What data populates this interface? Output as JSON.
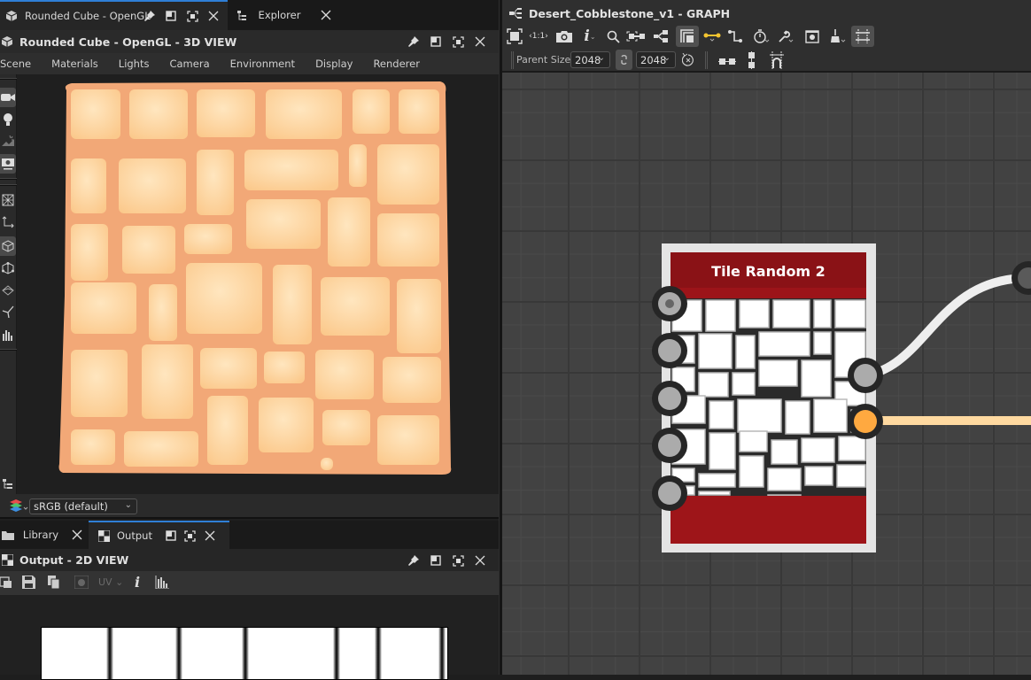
{
  "top_tabs": [
    {
      "label": "Rounded Cube - OpenGL",
      "icon": "cube-icon",
      "active": true
    },
    {
      "label": "Explorer",
      "icon": "tree-icon",
      "active": false
    }
  ],
  "view3d": {
    "title": "Rounded Cube - OpenGL - 3D VIEW",
    "menu": [
      "Scene",
      "Materials",
      "Lights",
      "Camera",
      "Environment",
      "Display",
      "Renderer"
    ],
    "side_tools": [
      "camera-icon",
      "light-bulb-icon",
      "environment-icon",
      "screenshot-icon",
      "wireframe-icon",
      "axes-icon",
      "cube-icon",
      "cube-vertices-icon",
      "uv-icon",
      "tangent-icon",
      "histogram-icon"
    ],
    "colorspace": "sRGB (default)"
  },
  "bottom_tabs": [
    {
      "label": "Library",
      "icon": "folder-icon",
      "active": false
    },
    {
      "label": "Output",
      "icon": "checker-icon",
      "active": true
    }
  ],
  "view2d": {
    "title": "Output - 2D VIEW",
    "uv_label": "UV"
  },
  "graph": {
    "title": "Desert_Cobblestone_v1 - GRAPH",
    "parent_size_label": "Parent Size:",
    "width_value": "2048",
    "height_value": "2048",
    "node": {
      "title": "Tile Random 2",
      "header_color": "#8a1216",
      "input_count": 5,
      "outputs": [
        "gray",
        "orange"
      ]
    },
    "connection_colors": {
      "gray": "#eeeeee",
      "orange": "#ffd9a0",
      "port_orange": "#ffa940"
    }
  }
}
